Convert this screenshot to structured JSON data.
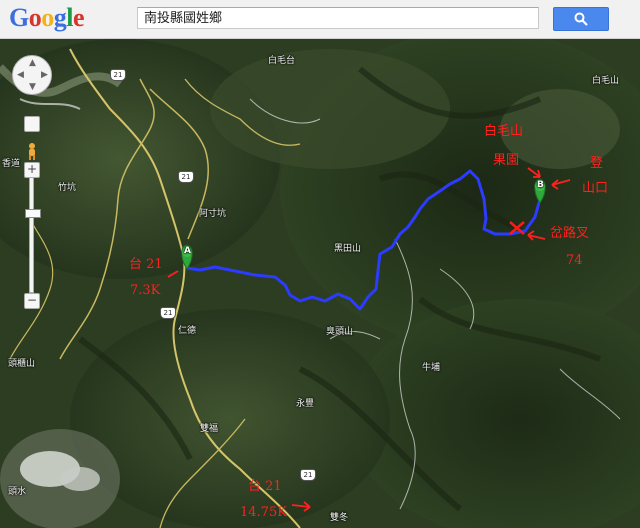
{
  "logo": {
    "text": "Google",
    "colors": [
      "#3b6fe0",
      "#d6362c",
      "#f2b21a",
      "#3b6fe0",
      "#1c9a49",
      "#d6362c"
    ]
  },
  "search": {
    "query": "南投縣國姓鄉"
  },
  "map": {
    "type": "satellite-route",
    "route_color": "#2b3cff",
    "markers": [
      {
        "label": "A",
        "color": "#2ea83a"
      },
      {
        "label": "B",
        "color": "#2ea83a"
      }
    ],
    "places": [
      "白毛台",
      "白毛山",
      "黑田山",
      "臭頭山",
      "牛埔",
      "永豐",
      "竹坑",
      "阿寸坑",
      "仁德",
      "雙福",
      "頭櫃山",
      "頭水",
      "香道",
      "雙冬"
    ],
    "road_shields": [
      "21",
      "21",
      "21",
      "21"
    ]
  },
  "annotations": {
    "mountain_label": "白毛山",
    "orchard": "果園",
    "trailhead_1": "登",
    "trailhead_2": "山口",
    "junction_1": "岔路",
    "junction_2": "叉",
    "junction_3": "路",
    "junction_km": "74",
    "road_a_name": "台 21",
    "road_a_km": "7.3K",
    "road_b_name": "台 21",
    "road_b_km": "14.75K"
  }
}
